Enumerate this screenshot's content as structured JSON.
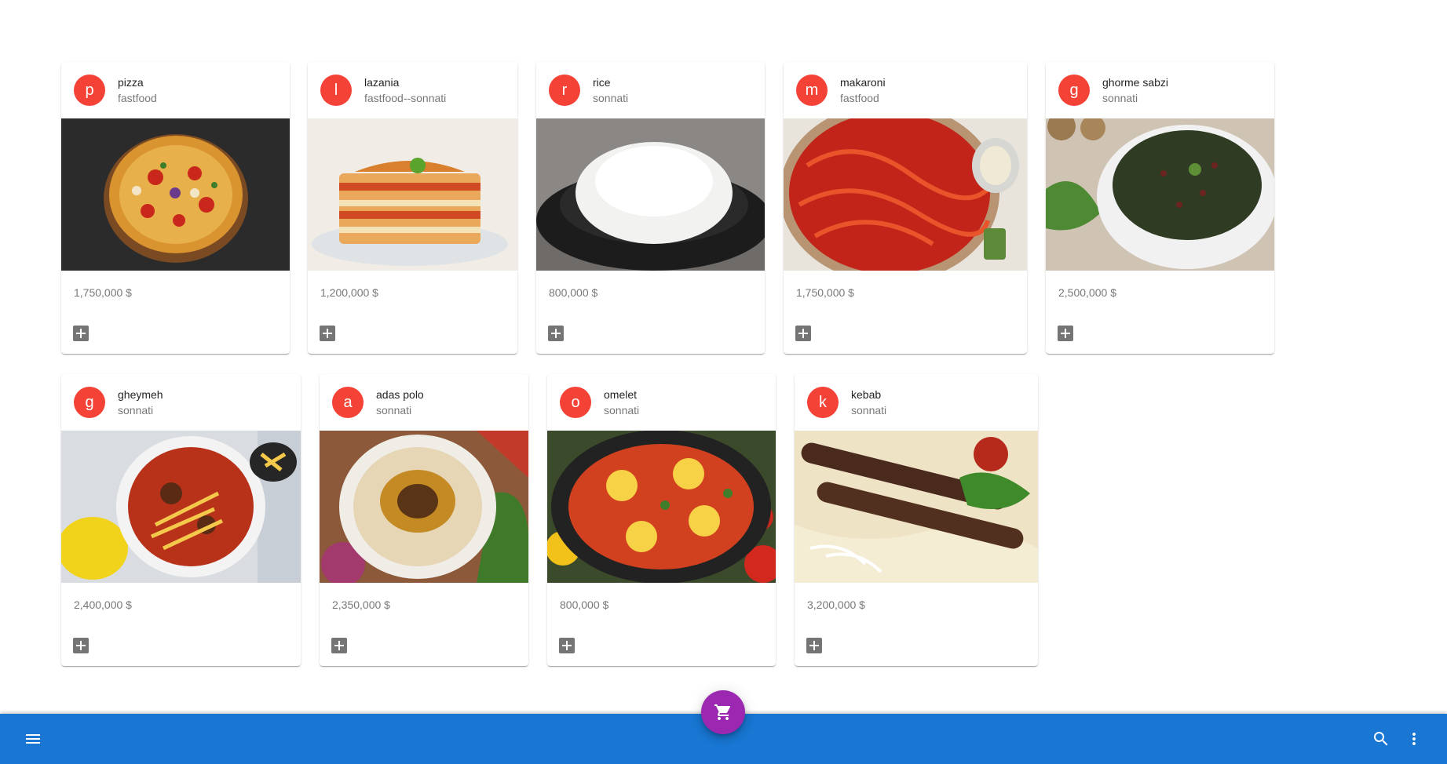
{
  "cards": [
    {
      "avatar": "p",
      "title": "pizza",
      "subheader": "fastfood",
      "price": "1,750,000 $",
      "image": "pizza"
    },
    {
      "avatar": "l",
      "title": "lazania",
      "subheader": "fastfood--sonnati",
      "price": "1,200,000 $",
      "image": "lasagna"
    },
    {
      "avatar": "r",
      "title": "rice",
      "subheader": "sonnati",
      "price": "800,000 $",
      "image": "rice"
    },
    {
      "avatar": "m",
      "title": "makaroni",
      "subheader": "fastfood",
      "price": "1,750,000 $",
      "image": "spaghetti"
    },
    {
      "avatar": "g",
      "title": "ghorme sabzi",
      "subheader": "sonnati",
      "price": "2,500,000 $",
      "image": "herb-stew"
    },
    {
      "avatar": "g",
      "title": "gheymeh",
      "subheader": "sonnati",
      "price": "2,400,000 $",
      "image": "split-pea-stew"
    },
    {
      "avatar": "a",
      "title": "adas polo",
      "subheader": "sonnati",
      "price": "2,350,000 $",
      "image": "lentil-rice"
    },
    {
      "avatar": "o",
      "title": "omelet",
      "subheader": "sonnati",
      "price": "800,000 $",
      "image": "tomato-eggs"
    },
    {
      "avatar": "k",
      "title": "kebab",
      "subheader": "sonnati",
      "price": "3,200,000 $",
      "image": "kebab"
    }
  ],
  "appbar": {
    "menu_icon": "menu-icon",
    "search_icon": "search-icon",
    "more_icon": "more-vert-icon",
    "color": "#1976d2"
  },
  "fab": {
    "icon": "cart-icon",
    "color": "#9c27b0"
  },
  "colors": {
    "avatar": "#f44336",
    "add_button": "#757575"
  }
}
